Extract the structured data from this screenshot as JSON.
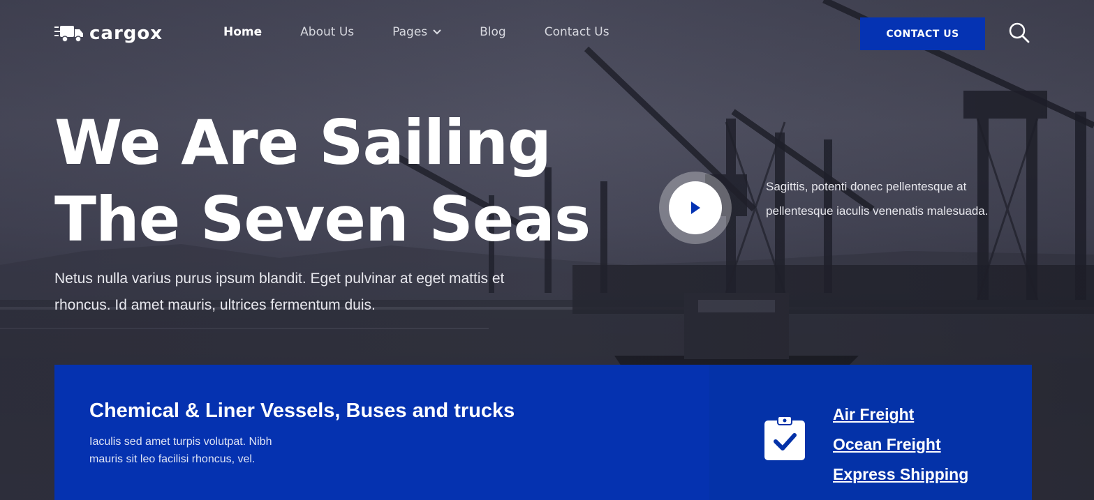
{
  "brand": {
    "name": "cargox",
    "accent": "#0533b3"
  },
  "nav": {
    "items": [
      {
        "label": "Home",
        "active": true
      },
      {
        "label": "About Us",
        "active": false
      },
      {
        "label": "Pages",
        "active": false,
        "dropdown": true
      },
      {
        "label": "Blog",
        "active": false
      },
      {
        "label": "Contact Us",
        "active": false
      }
    ],
    "cta_label": "CONTACT US",
    "search_icon": "search-icon"
  },
  "hero": {
    "title_line1": "We Are Sailing",
    "title_line2": "The Seven Seas",
    "description": "Netus nulla varius purus ipsum blandit. Eget pulvinar at eget mattis et rhoncus. Id amet mauris, ultrices fermentum duis.",
    "side_text": "Sagittis, potenti donec pellentesque at pellentesque iaculis venenatis malesuada.",
    "play_icon": "play-icon"
  },
  "info": {
    "title": "Chemical & Liner Vessels, Buses and trucks",
    "text": "Iaculis sed amet turpis volutpat. Nibh mauris sit leo facilisi rhoncus, vel.",
    "icon": "clipboard-check-icon",
    "links": [
      "Air Freight",
      "Ocean Freight",
      "Express Shipping"
    ]
  }
}
